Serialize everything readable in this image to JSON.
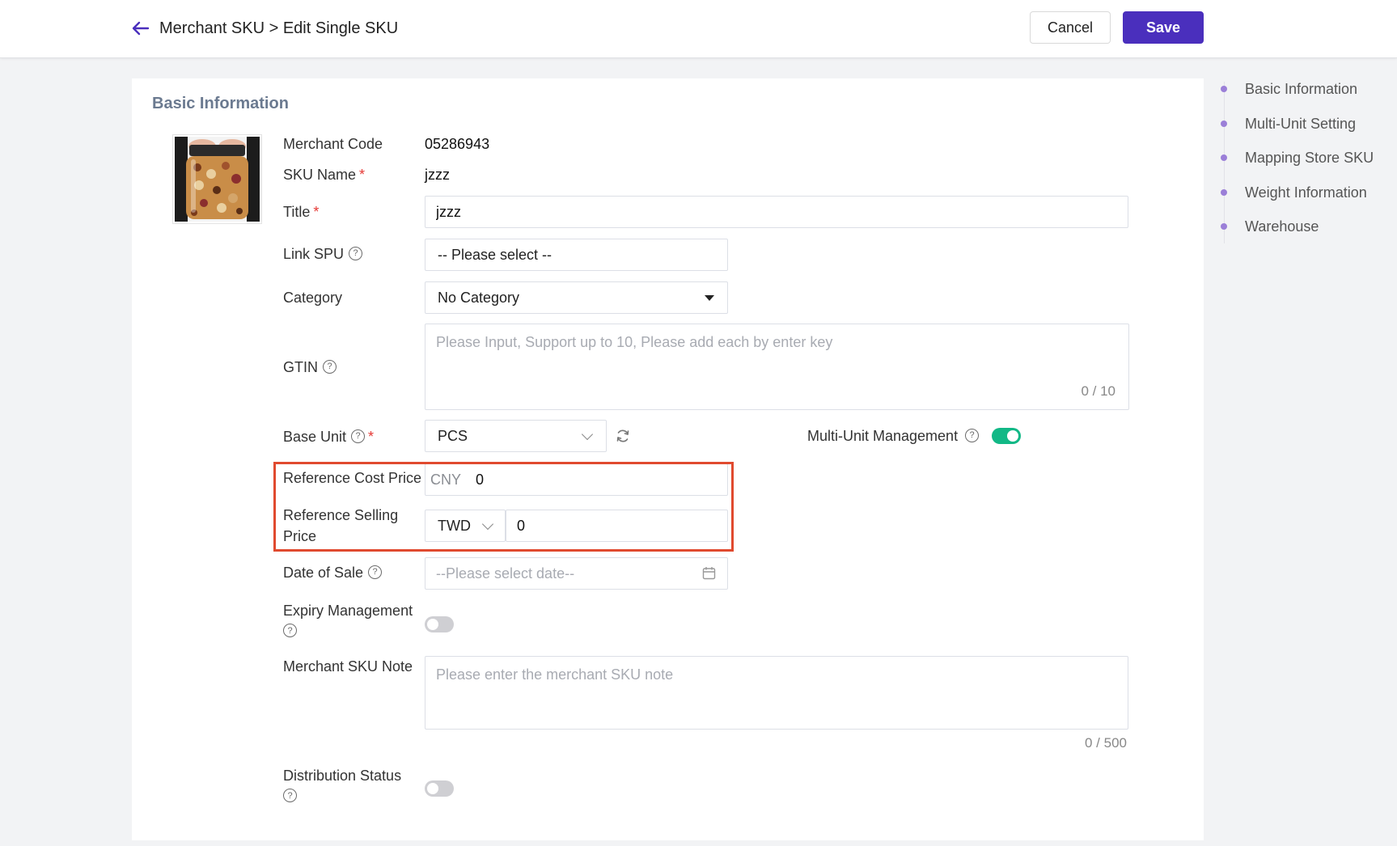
{
  "header": {
    "breadcrumb": "Merchant SKU > Edit Single SKU",
    "cancel_label": "Cancel",
    "save_label": "Save",
    "accent_color": "#4a2fbd"
  },
  "section": {
    "title": "Basic Information"
  },
  "form": {
    "merchant_code": {
      "label": "Merchant Code",
      "value": "05286943"
    },
    "sku_name": {
      "label": "SKU Name",
      "value": "jzzz"
    },
    "title": {
      "label": "Title",
      "value": "jzzz"
    },
    "link_spu": {
      "label": "Link SPU",
      "value": "-- Please select --"
    },
    "category": {
      "label": "Category",
      "value": "No Category"
    },
    "gtin": {
      "label": "GTIN",
      "placeholder": "Please Input, Support up to 10, Please add each by enter key",
      "counter": "0 / 10"
    },
    "base_unit": {
      "label": "Base Unit",
      "value": "PCS"
    },
    "multi_unit": {
      "label": "Multi-Unit Management",
      "enabled": true
    },
    "ref_cost_price": {
      "label": "Reference Cost Price",
      "currency": "CNY",
      "value": "0"
    },
    "ref_selling_price": {
      "label_line1": "Reference Selling",
      "label_line2": "Price",
      "currency": "TWD",
      "value": "0"
    },
    "date_of_sale": {
      "label": "Date of Sale",
      "placeholder": "--Please select date--"
    },
    "expiry_management": {
      "label": "Expiry Management",
      "enabled": false
    },
    "merchant_sku_note": {
      "label": "Merchant SKU Note",
      "placeholder": "Please enter the merchant SKU note",
      "counter": "0 / 500"
    },
    "distribution_status": {
      "label": "Distribution Status",
      "enabled": false
    }
  },
  "side_nav": {
    "items": [
      {
        "label": "Basic Information"
      },
      {
        "label": "Multi-Unit Setting"
      },
      {
        "label": "Mapping Store SKU"
      },
      {
        "label": "Weight Information"
      },
      {
        "label": "Warehouse"
      }
    ]
  },
  "icons": {
    "back": "arrow-left-icon",
    "help": "question-circle-icon",
    "refresh": "refresh-icon",
    "calendar": "calendar-icon"
  }
}
